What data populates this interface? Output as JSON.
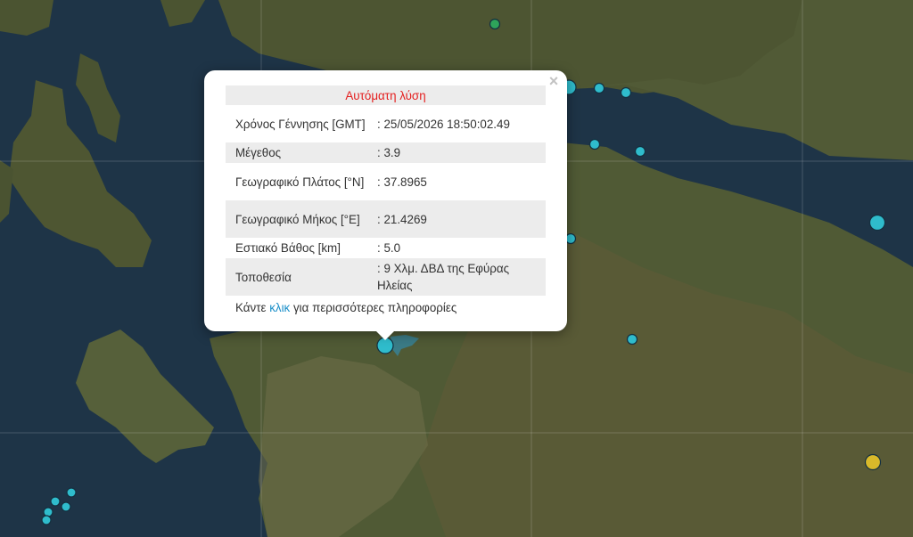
{
  "popup": {
    "title": "Αυτόματη λύση",
    "close_label": "×",
    "rows": [
      {
        "label": "Χρόνος Γέννησης [GMT]",
        "value": ": 25/05/2026 18:50:02.49"
      },
      {
        "label": "Μέγεθος",
        "value": ": 3.9"
      },
      {
        "label": "Γεωγραφικό Πλάτος [°N]",
        "value": ": 37.8965"
      },
      {
        "label": "Γεωγραφικό Μήκος [°E]",
        "value": ": 21.4269"
      },
      {
        "label": "Εστιακό Βάθος [km]",
        "value": ": 5.0"
      },
      {
        "label": "Τοποθεσία",
        "value": ": 9 Χλμ. ΔΒΔ της Εφύρας Ηλείας"
      }
    ],
    "more_prefix": "Κάντε ",
    "more_link": "κλικ",
    "more_suffix": " για περισσότερες πληροφορίες"
  },
  "colors": {
    "sea": "#1d3346",
    "land": "#4f5a34",
    "marker_recent": "#2fbccc",
    "marker_green": "#2ea35a",
    "marker_yellow": "#d9b92a",
    "popup_title": "#e41e1e",
    "link": "#1b8fc9"
  }
}
